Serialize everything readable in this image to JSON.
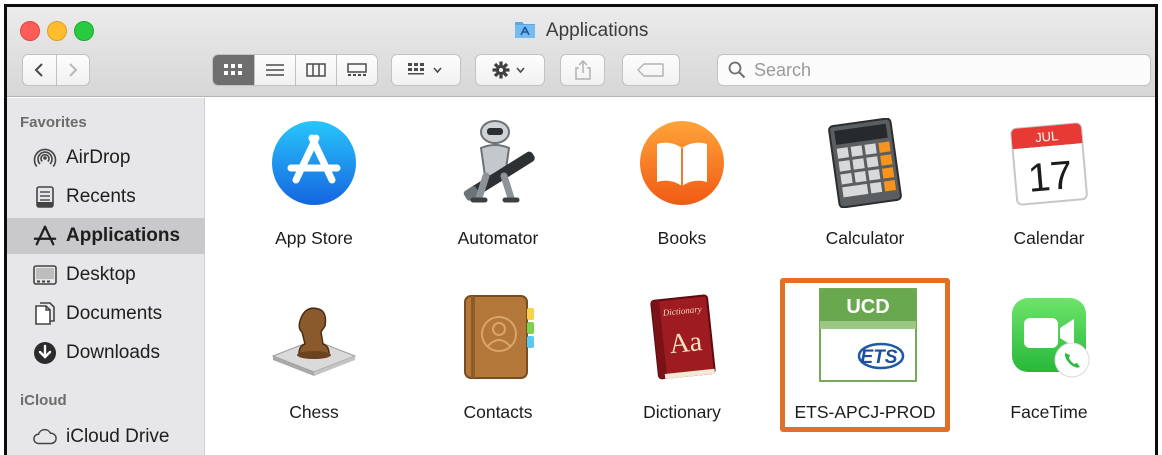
{
  "window": {
    "title": "Applications",
    "controls": [
      "close",
      "minimize",
      "maximize"
    ]
  },
  "toolbar": {
    "nav_back_icon": "chevron-left-icon",
    "nav_forward_icon": "chevron-right-icon",
    "views": [
      "icon-view",
      "list-view",
      "column-view",
      "gallery-view"
    ],
    "search_placeholder": "Search"
  },
  "sidebar": {
    "favorites_heading": "Favorites",
    "items": [
      {
        "label": "AirDrop",
        "icon": "airdrop-icon"
      },
      {
        "label": "Recents",
        "icon": "recents-icon"
      },
      {
        "label": "Applications",
        "icon": "applications-icon",
        "selected": true
      },
      {
        "label": "Desktop",
        "icon": "desktop-icon"
      },
      {
        "label": "Documents",
        "icon": "documents-icon"
      },
      {
        "label": "Downloads",
        "icon": "downloads-icon"
      }
    ],
    "icloud_heading": "iCloud",
    "icloud_items": [
      {
        "label": "iCloud Drive",
        "icon": "icloud-drive-icon"
      }
    ]
  },
  "apps": [
    {
      "label": "App Store",
      "icon": "app-store-icon"
    },
    {
      "label": "Automator",
      "icon": "automator-icon"
    },
    {
      "label": "Books",
      "icon": "books-icon"
    },
    {
      "label": "Calculator",
      "icon": "calculator-icon"
    },
    {
      "label": "Calendar",
      "icon": "calendar-icon",
      "month": "JUL",
      "day": "17"
    },
    {
      "label": "Chess",
      "icon": "chess-icon"
    },
    {
      "label": "Contacts",
      "icon": "contacts-icon"
    },
    {
      "label": "Dictionary",
      "icon": "dictionary-icon",
      "cover_text": "Dictionary",
      "glyph": "Aa"
    },
    {
      "label": "ETS-APCJ-PROD",
      "icon": "ets-icon",
      "banner": "UCD",
      "logo_text": "ETS",
      "highlighted": true
    },
    {
      "label": "FaceTime",
      "icon": "facetime-icon"
    }
  ],
  "colors": {
    "highlight": "#e06f27",
    "selection": "#c9c8cb",
    "sidebar_bg": "#e7e6e8"
  }
}
